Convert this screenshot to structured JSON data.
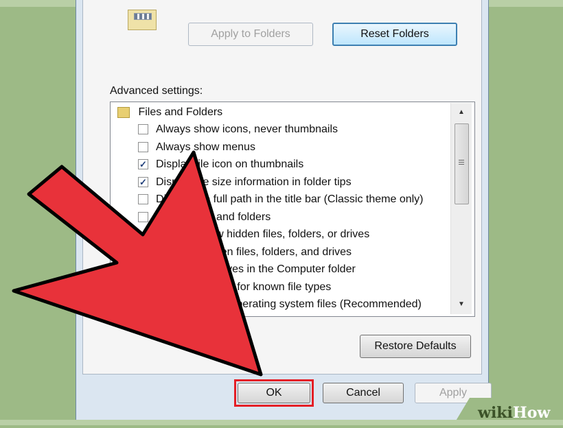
{
  "folder_views": {
    "apply_button": "Apply to Folders",
    "reset_button": "Reset Folders"
  },
  "advanced": {
    "label": "Advanced settings:",
    "group_label": "Files and Folders",
    "items": [
      {
        "text": "Always show icons, never thumbnails",
        "checked": false
      },
      {
        "text": "Always show menus",
        "checked": false
      },
      {
        "text": "Display file icon on thumbnails",
        "checked": true
      },
      {
        "text": "Display file size information in folder tips",
        "checked": true
      },
      {
        "text": "Display the full path in the title bar (Classic theme only)",
        "checked": false
      },
      {
        "text": "Hidden files and folders",
        "checked": false
      },
      {
        "text": "Don't show hidden files, folders, or drives",
        "checked": false
      },
      {
        "text": "Show hidden files, folders, and drives",
        "checked": false
      },
      {
        "text": "Hide empty drives in the Computer folder",
        "checked": false
      },
      {
        "text": "Hide extensions for known file types",
        "checked": false
      },
      {
        "text": "Hide protected operating system files (Recommended)",
        "checked": false
      }
    ],
    "restore_button": "Restore Defaults"
  },
  "dialog": {
    "ok_button": "OK",
    "cancel_button": "Cancel",
    "apply_button": "Apply"
  },
  "watermark": {
    "part1": "wiki",
    "part2": "How"
  },
  "colors": {
    "highlight": "#e41f26",
    "arrow_fill": "#e8323a",
    "background": "#9dba86"
  }
}
